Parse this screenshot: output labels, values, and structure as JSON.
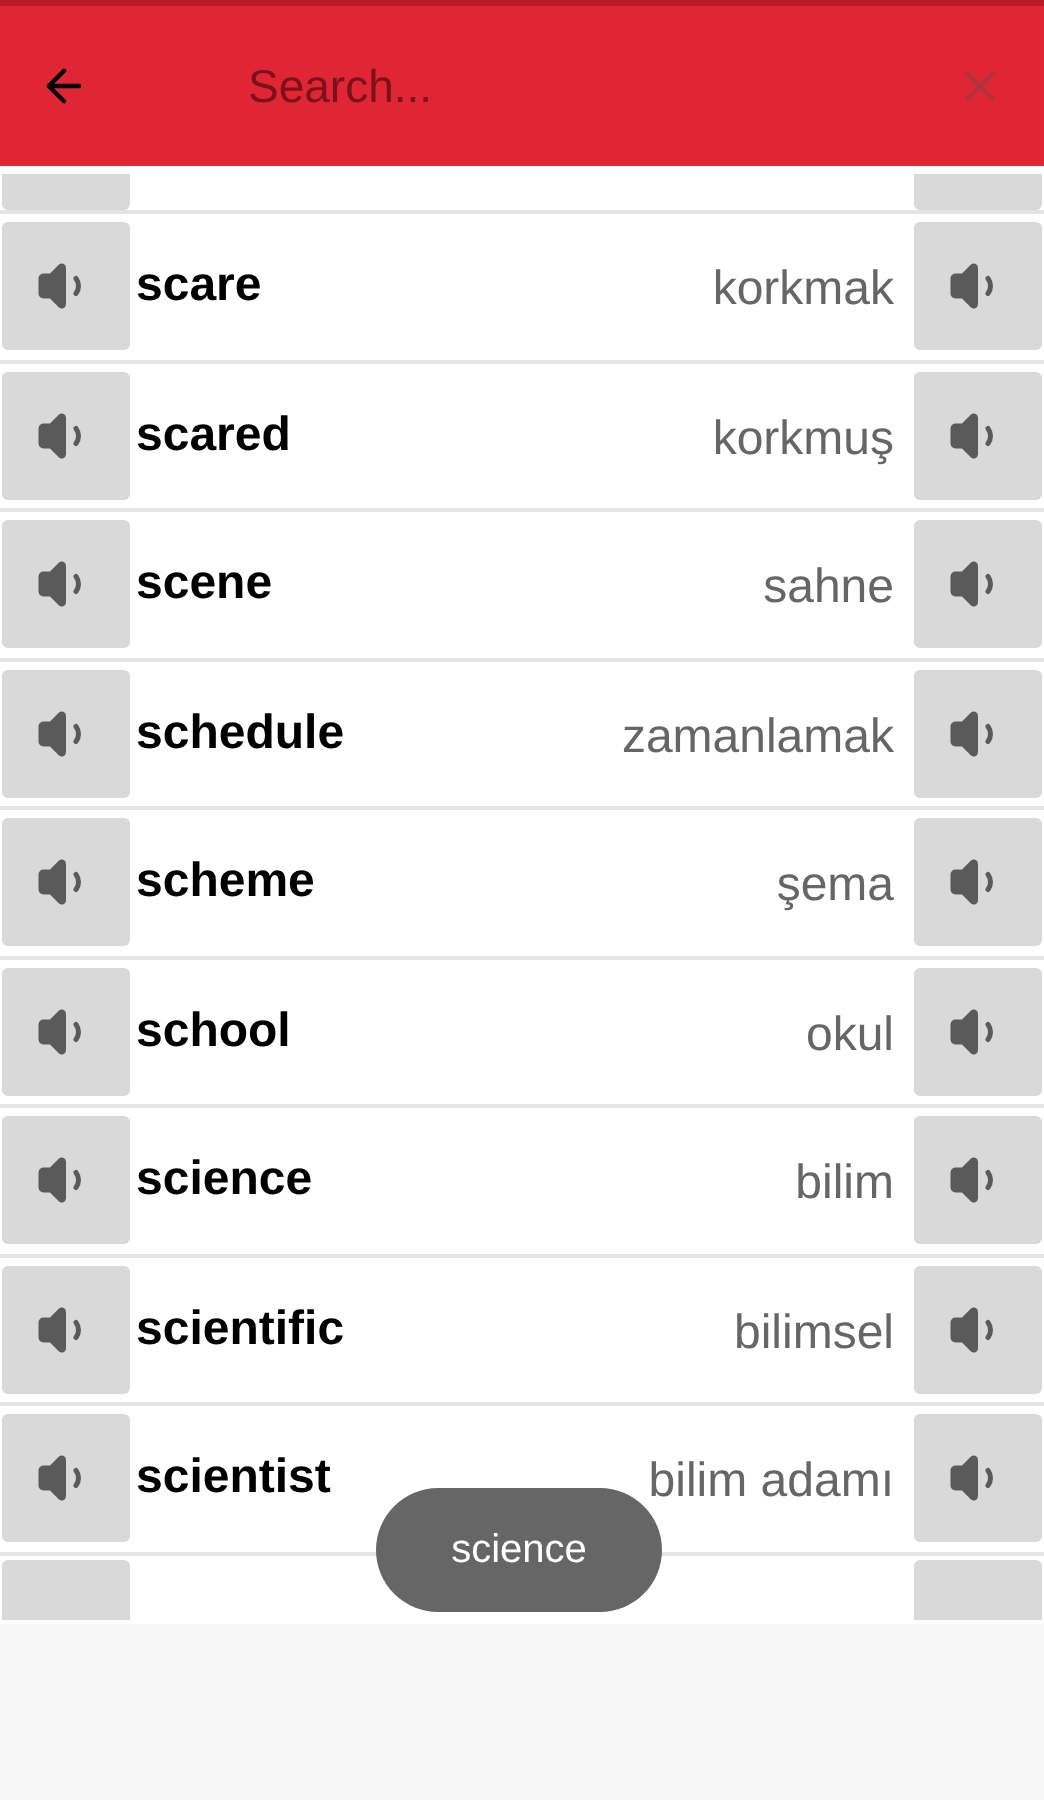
{
  "search": {
    "placeholder": "Search..."
  },
  "words": [
    {
      "word": "scare",
      "translation": "korkmak"
    },
    {
      "word": "scared",
      "translation": "korkmuş"
    },
    {
      "word": "scene",
      "translation": "sahne"
    },
    {
      "word": "schedule",
      "translation": "zamanlamak"
    },
    {
      "word": "scheme",
      "translation": "şema"
    },
    {
      "word": "school",
      "translation": "okul"
    },
    {
      "word": "science",
      "translation": "bilim"
    },
    {
      "word": "scientific",
      "translation": "bilimsel"
    },
    {
      "word": "scientist",
      "translation": "bilim adamı"
    }
  ],
  "toast": "science"
}
